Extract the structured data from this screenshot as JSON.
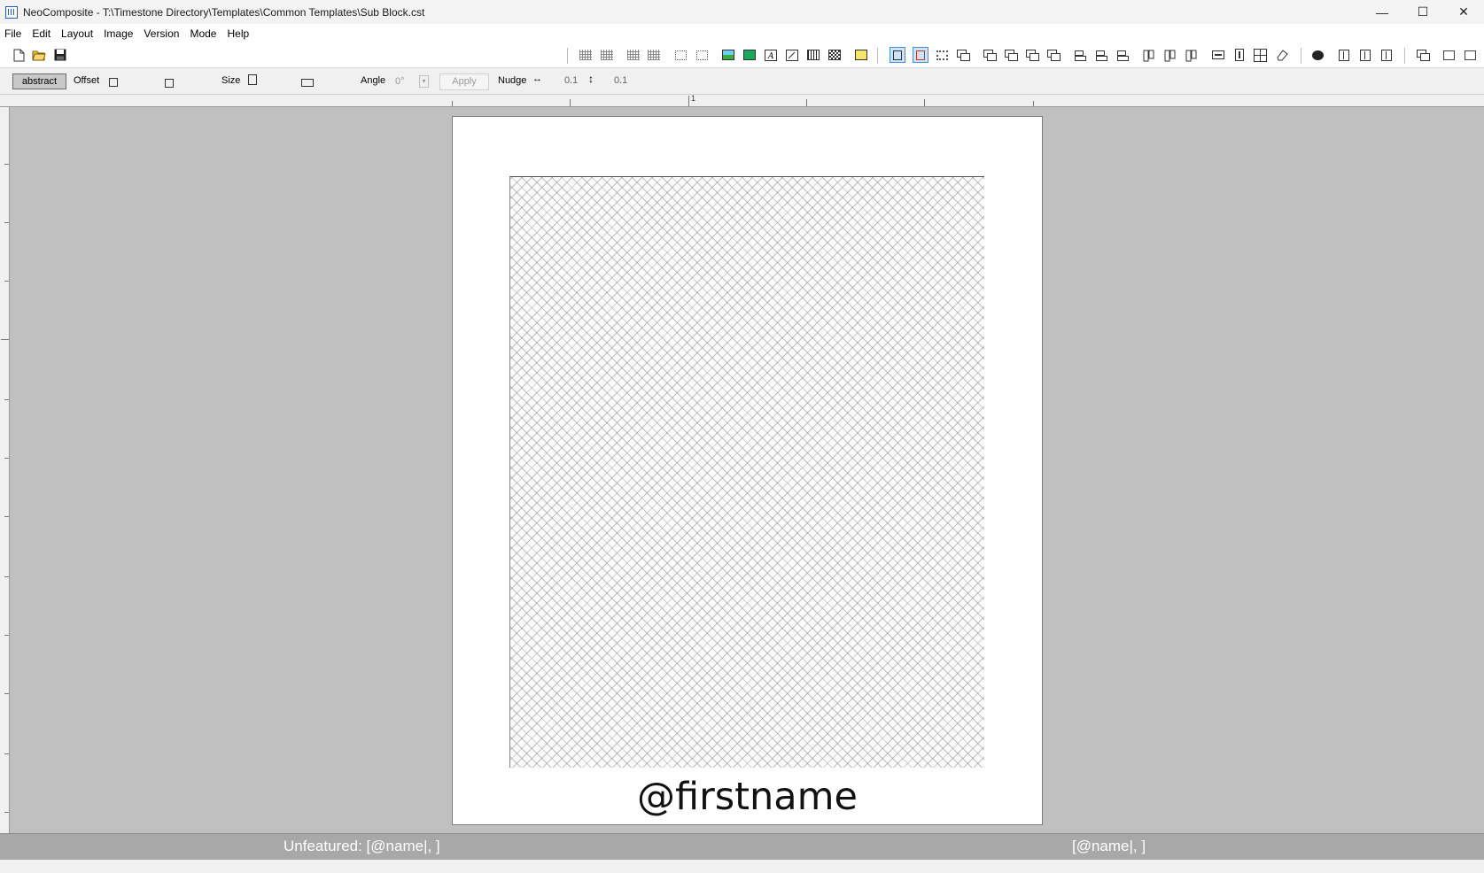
{
  "window": {
    "title": "NeoComposite - T:\\Timestone Directory\\Templates\\Common Templates\\Sub Block.cst",
    "minimize": "—",
    "maximize": "☐",
    "close": "✕"
  },
  "menu": [
    "File",
    "Edit",
    "Layout",
    "Image",
    "Version",
    "Mode",
    "Help"
  ],
  "properties": {
    "mode_button": "abstract",
    "offset_label": "Offset",
    "size_label": "Size",
    "angle_label": "Angle",
    "angle_value": "0°",
    "apply_label": "Apply",
    "nudge_label": "Nudge",
    "nudge_h_value": "0.1",
    "nudge_v_value": "0.1"
  },
  "ruler": {
    "top_label": "1"
  },
  "canvas": {
    "field_text": "@firstname"
  },
  "status": {
    "left": "Unfeatured: [@name|, ]",
    "right": "[@name|, ]"
  }
}
